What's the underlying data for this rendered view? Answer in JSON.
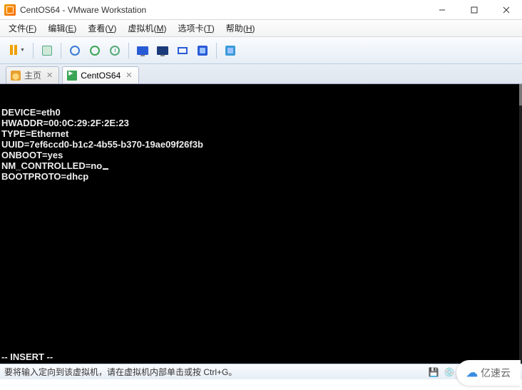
{
  "window": {
    "title": "CentOS64 - VMware Workstation"
  },
  "menu": {
    "file": {
      "label": "文件",
      "key": "F"
    },
    "edit": {
      "label": "编辑",
      "key": "E"
    },
    "view": {
      "label": "查看",
      "key": "V"
    },
    "vm": {
      "label": "虚拟机",
      "key": "M"
    },
    "tabs": {
      "label": "选项卡",
      "key": "T"
    },
    "help": {
      "label": "帮助",
      "key": "H"
    }
  },
  "tabs": {
    "home": {
      "label": "主页"
    },
    "centos": {
      "label": "CentOS64"
    }
  },
  "terminal": {
    "lines": [
      "DEVICE=eth0",
      "HWADDR=00:0C:29:2F:2E:23",
      "TYPE=Ethernet",
      "UUID=7ef6ccd0-b1c2-4b55-b370-19ae09f26f3b",
      "ONBOOT=yes",
      "NM_CONTROLLED=no",
      "BOOTPROTO=dhcp"
    ],
    "cursor_line": 5,
    "status": "-- INSERT --"
  },
  "statusbar": {
    "message": "要将输入定向到该虚拟机，请在虚拟机内部单击或按 Ctrl+G。"
  },
  "watermark": {
    "text": "亿速云"
  }
}
